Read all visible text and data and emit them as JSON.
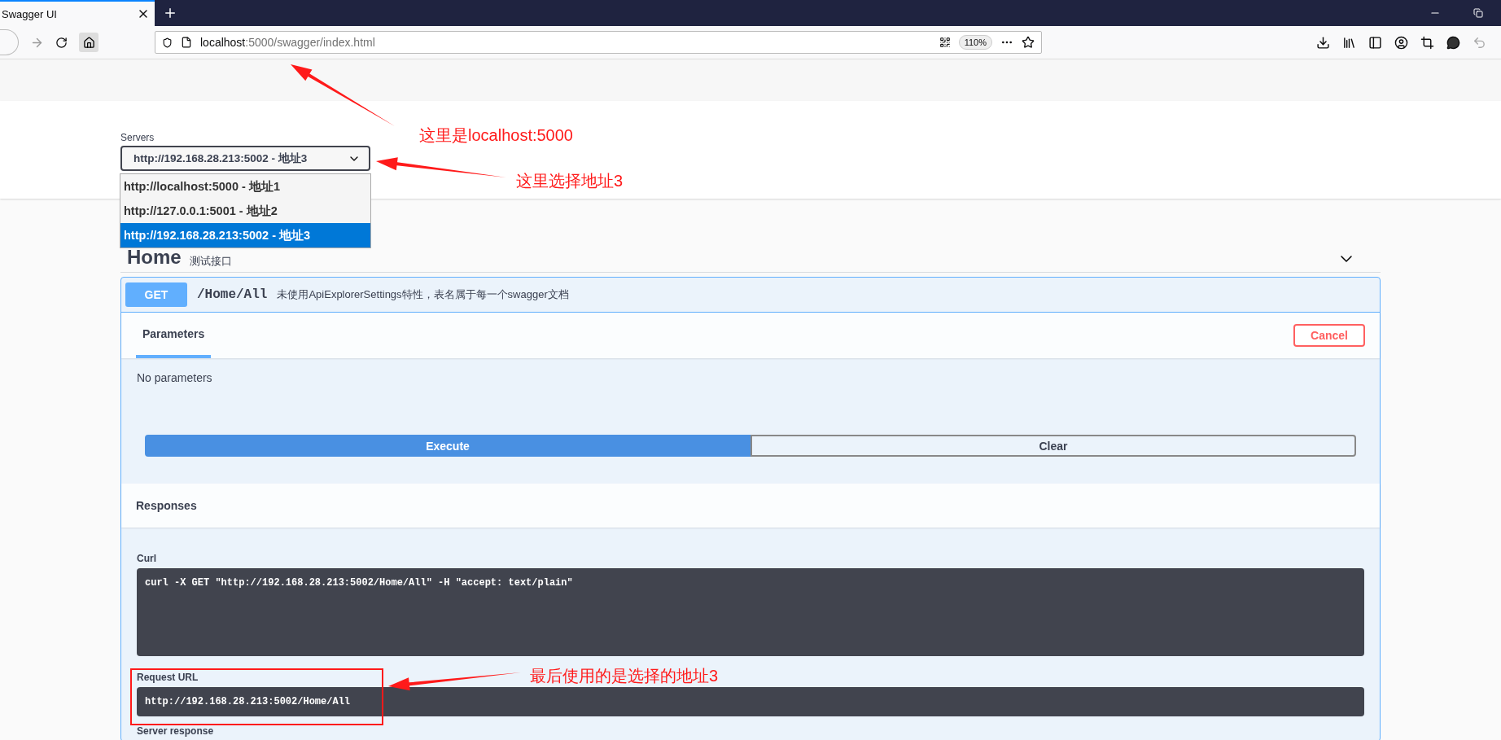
{
  "browser": {
    "tab_title": "Swagger UI",
    "address_host": "localhost",
    "address_rest": ":5000/swagger/index.html",
    "zoom": "110%"
  },
  "servers": {
    "label": "Servers",
    "value": "http://192.168.28.213:5002 - 地址3",
    "options": [
      {
        "label": "http://localhost:5000 - 地址1",
        "selected": false
      },
      {
        "label": "http://127.0.0.1:5001 - 地址2",
        "selected": false
      },
      {
        "label": "http://192.168.28.213:5002 - 地址3",
        "selected": true
      }
    ]
  },
  "tag": {
    "name": "Home",
    "description": "测试接口"
  },
  "operation": {
    "method": "GET",
    "path": "/Home/All",
    "summary": "未使用ApiExplorerSettings特性，表名属于每一个swagger文档",
    "tabs": [
      {
        "label": "Parameters",
        "selected": true
      }
    ],
    "cancel": "Cancel",
    "no_params": "No parameters",
    "buttons": [
      {
        "label": "Execute",
        "kind": "primary"
      },
      {
        "label": "Clear",
        "kind": "secondary"
      }
    ],
    "responses_title": "Responses",
    "curl_label": "Curl",
    "curl": "curl -X GET \"http://192.168.28.213:5002/Home/All\" -H \"accept: text/plain\"",
    "request_url_label": "Request URL",
    "request_url": "http://192.168.28.213:5002/Home/All",
    "server_response_label": "Server response"
  },
  "annotations": [
    {
      "text": "这里是localhost:5000"
    },
    {
      "text": "这里选择地址3"
    },
    {
      "text": "最后使用的是选择的地址3"
    }
  ]
}
